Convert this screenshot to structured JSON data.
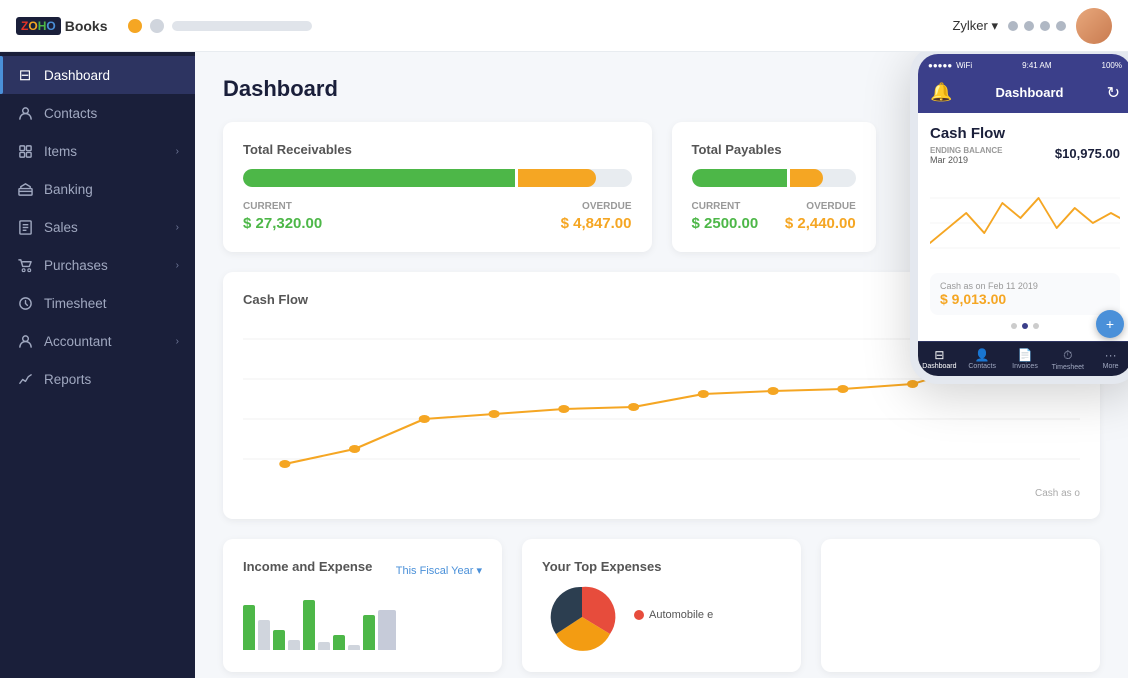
{
  "topbar": {
    "logo": {
      "z": "Z",
      "o1": "O",
      "h": "H",
      "o2": "O",
      "books": " Books"
    },
    "user": "Zylker ▾"
  },
  "sidebar": {
    "items": [
      {
        "id": "dashboard",
        "label": "Dashboard",
        "icon": "⊡",
        "active": true,
        "hasChevron": false
      },
      {
        "id": "contacts",
        "label": "Contacts",
        "icon": "👤",
        "active": false,
        "hasChevron": false
      },
      {
        "id": "items",
        "label": "Items",
        "icon": "🛒",
        "active": false,
        "hasChevron": true
      },
      {
        "id": "banking",
        "label": "Banking",
        "icon": "🏛",
        "active": false,
        "hasChevron": false
      },
      {
        "id": "sales",
        "label": "Sales",
        "icon": "📄",
        "active": false,
        "hasChevron": true
      },
      {
        "id": "purchases",
        "label": "Purchases",
        "icon": "🛍",
        "active": false,
        "hasChevron": true
      },
      {
        "id": "timesheet",
        "label": "Timesheet",
        "icon": "⏱",
        "active": false,
        "hasChevron": false
      },
      {
        "id": "accountant",
        "label": "Accountant",
        "icon": "👤",
        "active": false,
        "hasChevron": true
      },
      {
        "id": "reports",
        "label": "Reports",
        "icon": "📈",
        "active": false,
        "hasChevron": false
      }
    ]
  },
  "dashboard": {
    "title": "Dashboard",
    "total_receivables": {
      "title": "Total Receivables",
      "current_label": "CURRENT",
      "current_value": "$ 27,320.00",
      "overdue_label": "OVERDUE",
      "overdue_value": "$ 4,847.00",
      "current_pct": 70,
      "overdue_pct": 15
    },
    "total_payables": {
      "title": "Total Payables",
      "current_label": "CURRENT",
      "current_value": "$ 2500.00",
      "overdue_label": "OVERDUE",
      "overdue_value": "$ 2,440.00",
      "current_pct": 55,
      "overdue_pct": 15
    },
    "cash_flow": {
      "title": "Cash Flow",
      "label_right": "Cash as o",
      "label_bottom": "Cash as o"
    },
    "income_expense": {
      "title": "Income and Expense",
      "period": "This Fiscal Year ▾"
    },
    "top_expenses": {
      "title": "Your Top Expenses",
      "legend": [
        {
          "label": "Automobile e",
          "color": "#e74c3c"
        }
      ]
    },
    "mobile": {
      "status_time": "9:41 AM",
      "status_battery": "100%",
      "nav_title": "Dashboard",
      "card_title": "Cash Flow",
      "balance_label": "ENDING BALANCE",
      "balance_date": "Mar 2019",
      "balance_amount": "$10,975.00",
      "cash_label": "Cash as on Feb 11 2019",
      "cash_value": "$ 9,013.00",
      "bottom_nav": [
        {
          "label": "Dashboard",
          "icon": "⊡",
          "active": true
        },
        {
          "label": "Contacts",
          "icon": "👤",
          "active": false
        },
        {
          "label": "Invoices",
          "icon": "📄",
          "active": false
        },
        {
          "label": "Timesheet",
          "icon": "⏱",
          "active": false
        },
        {
          "label": "More",
          "icon": "•••",
          "active": false
        }
      ]
    }
  }
}
